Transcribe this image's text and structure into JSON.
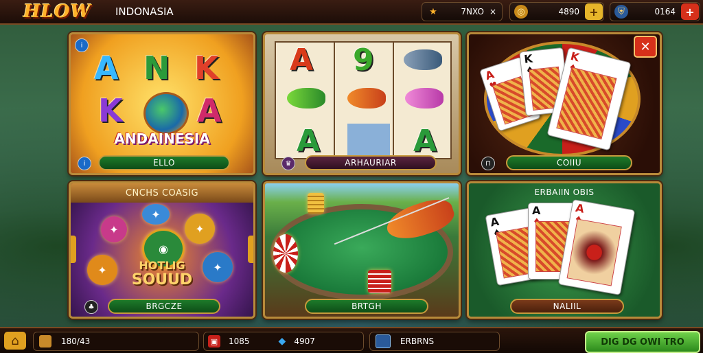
{
  "header": {
    "logo": "HLOW",
    "region": "INDONASIA",
    "stat1": {
      "icon": "star-icon",
      "value": "7NXO",
      "suffix": "×"
    },
    "stat2": {
      "icon": "coin-icon",
      "value": "4890",
      "suffix": "+"
    },
    "stat3": {
      "icon": "shield-icon",
      "value": "0164",
      "suffix": "+"
    }
  },
  "panels": [
    {
      "id": "alphabet",
      "title_letters": [
        "A",
        "N",
        "K",
        "K",
        "A"
      ],
      "subtitle": "ANDAINESIA",
      "button": "ELLO"
    },
    {
      "id": "slots",
      "reel_letters": [
        "A",
        "9",
        "A",
        "A"
      ],
      "button": "ARHAURIAR"
    },
    {
      "id": "cards-roulette",
      "button": "COIIU",
      "card_ranks": [
        "A",
        "K",
        "K"
      ]
    },
    {
      "id": "coins",
      "title": "CNCHS COASIG",
      "subtitle_line1": "HOTLIG",
      "subtitle_line2": "SOUUD",
      "button": "BRGCZE"
    },
    {
      "id": "fishing",
      "button": "BRTGH"
    },
    {
      "id": "cards-green",
      "title": "ERBAIIN OBIS",
      "card_ranks": [
        "A",
        "A",
        "A"
      ],
      "button": "NALIIL"
    }
  ],
  "footer": {
    "slot1": {
      "icon": "wallet-icon",
      "value": "180/43"
    },
    "slot2": {
      "icon": "gift-icon",
      "value": "1085"
    },
    "slot3": {
      "icon": "gem-icon",
      "value": "4907"
    },
    "slot4": {
      "icon": "list-icon",
      "value": "ERBRNS"
    },
    "cta": "DIG DG OWI TRO"
  },
  "colors": {
    "accent": "#ffb12a",
    "green": "#1d7a2a",
    "close": "#d6301a"
  }
}
